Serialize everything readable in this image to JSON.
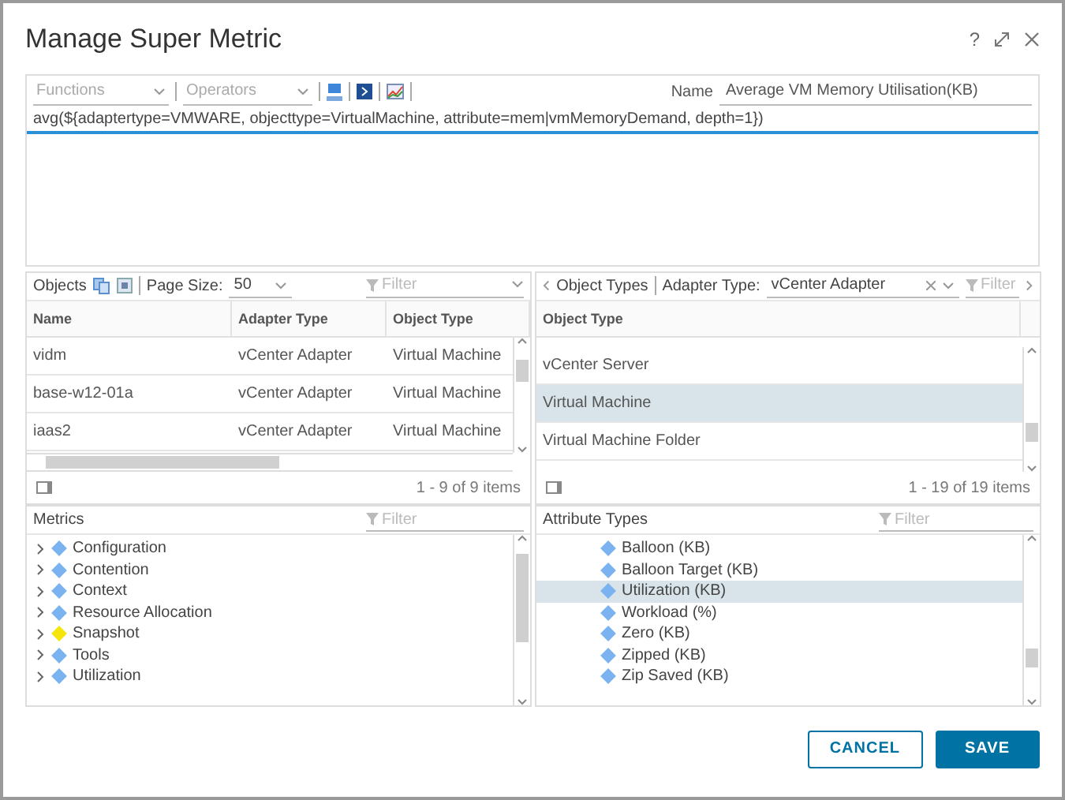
{
  "dialog": {
    "title": "Manage Super Metric",
    "help": "?"
  },
  "editor": {
    "functions_label": "Functions",
    "operators_label": "Operators",
    "name_label": "Name",
    "name_value": "Average VM Memory Utilisation(KB)",
    "formula": "avg(${adaptertype=VMWARE, objecttype=VirtualMachine, attribute=mem|vmMemoryDemand, depth=1})"
  },
  "objects": {
    "title": "Objects",
    "page_size_label": "Page Size:",
    "page_size": "50",
    "filter_placeholder": "Filter",
    "columns": [
      "Name",
      "Adapter Type",
      "Object Type"
    ],
    "rows": [
      {
        "cells": [
          "vidm",
          "vCenter Adapter",
          "Virtual Machine"
        ],
        "selected": false
      },
      {
        "cells": [
          "base-w12-01a",
          "vCenter Adapter",
          "Virtual Machine"
        ],
        "selected": false
      },
      {
        "cells": [
          "iaas2",
          "vCenter Adapter",
          "Virtual Machine"
        ],
        "selected": false
      }
    ],
    "footer": "1 - 9 of 9 items"
  },
  "object_types": {
    "title": "Object Types",
    "adapter_label": "Adapter Type:",
    "adapter_value": "vCenter Adapter",
    "filter_placeholder": "Filter",
    "columns": [
      "Object Type"
    ],
    "rows": [
      {
        "label": "vCenter Server",
        "selected": false
      },
      {
        "label": "Virtual Machine",
        "selected": true
      },
      {
        "label": "Virtual Machine Folder",
        "selected": false
      }
    ],
    "footer": "1 - 19 of 19 items"
  },
  "metrics": {
    "title": "Metrics",
    "filter_placeholder": "Filter",
    "items": [
      {
        "label": "Configuration",
        "color": "#7ab3f0",
        "expanded": false
      },
      {
        "label": "Contention",
        "color": "#7ab3f0",
        "expanded": false
      },
      {
        "label": "Context",
        "color": "#7ab3f0",
        "expanded": false
      },
      {
        "label": "Resource Allocation",
        "color": "#7ab3f0",
        "expanded": false
      },
      {
        "label": "Snapshot",
        "color": "#f5e50a",
        "expanded": false
      },
      {
        "label": "Tools",
        "color": "#7ab3f0",
        "expanded": false
      },
      {
        "label": "Utilization",
        "color": "#7ab3f0",
        "expanded": false
      }
    ]
  },
  "attribute_types": {
    "title": "Attribute Types",
    "filter_placeholder": "Filter",
    "items": [
      {
        "label": "Balloon (KB)",
        "selected": false
      },
      {
        "label": "Balloon Target (KB)",
        "selected": false
      },
      {
        "label": "Utilization (KB)",
        "selected": true
      },
      {
        "label": "Workload (%)",
        "selected": false
      },
      {
        "label": "Zero (KB)",
        "selected": false
      },
      {
        "label": "Zipped (KB)",
        "selected": false
      },
      {
        "label": "Zip Saved (KB)",
        "selected": false
      }
    ]
  },
  "buttons": [
    {
      "label": "CANCEL",
      "kind": "secondary"
    },
    {
      "label": "SAVE",
      "kind": "primary"
    }
  ]
}
